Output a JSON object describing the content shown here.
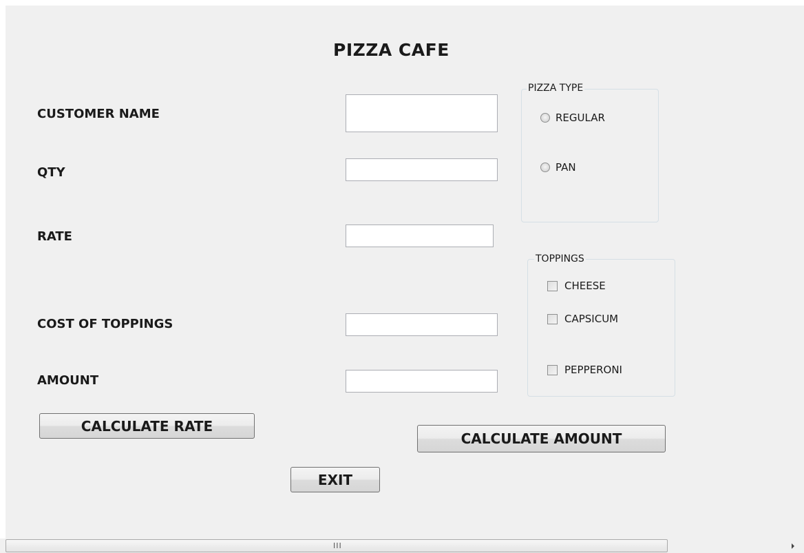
{
  "window": {
    "title": "PIZZA CAFE"
  },
  "form": {
    "labels": {
      "customer_name": "CUSTOMER NAME",
      "qty": "QTY",
      "rate": "RATE",
      "cost_of_toppings": "COST OF TOPPINGS",
      "amount": "AMOUNT"
    },
    "fields": {
      "customer_name": "",
      "qty": "",
      "rate": "",
      "cost_of_toppings": "",
      "amount": ""
    }
  },
  "pizza_type": {
    "caption": "PIZZA TYPE",
    "options": [
      {
        "label": "REGULAR",
        "selected": false
      },
      {
        "label": "PAN",
        "selected": false
      }
    ]
  },
  "toppings": {
    "caption": "TOPPINGS",
    "options": [
      {
        "label": "CHEESE",
        "checked": false
      },
      {
        "label": "CAPSICUM",
        "checked": false
      },
      {
        "label": "PEPPERONI",
        "checked": false
      }
    ]
  },
  "buttons": {
    "calculate_rate": "CALCULATE RATE",
    "calculate_amount": "CALCULATE AMOUNT",
    "exit": "EXIT"
  },
  "scrollbar": {
    "grip": "III"
  }
}
